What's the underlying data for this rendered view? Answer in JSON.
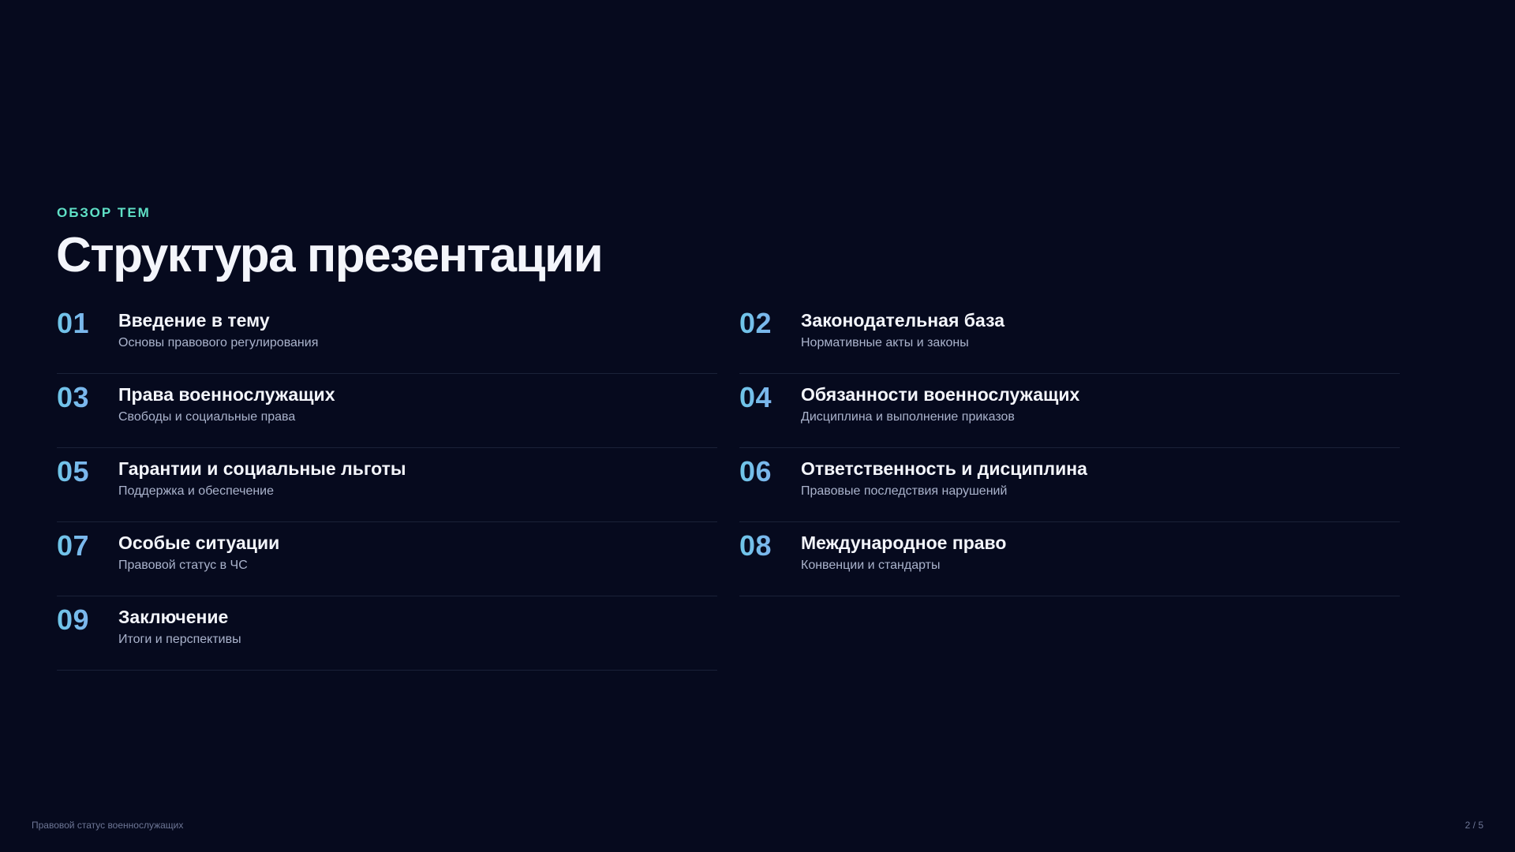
{
  "header": {
    "eyebrow": "ОБЗОР ТЕМ",
    "title": "Структура презентации"
  },
  "items": [
    {
      "num": "01",
      "title": "Введение в тему",
      "subtitle": "Основы правового регулирования"
    },
    {
      "num": "02",
      "title": "Законодательная база",
      "subtitle": "Нормативные акты и законы"
    },
    {
      "num": "03",
      "title": "Права военнослужащих",
      "subtitle": "Свободы и социальные права"
    },
    {
      "num": "04",
      "title": "Обязанности военнослужащих",
      "subtitle": "Дисциплина и выполнение приказов"
    },
    {
      "num": "05",
      "title": "Гарантии и социальные льготы",
      "subtitle": "Поддержка и обеспечение"
    },
    {
      "num": "06",
      "title": "Ответственность и дисциплина",
      "subtitle": "Правовые последствия нарушений"
    },
    {
      "num": "07",
      "title": "Особые ситуации",
      "subtitle": "Правовой статус в ЧС"
    },
    {
      "num": "08",
      "title": "Международное право",
      "subtitle": "Конвенции и стандарты"
    },
    {
      "num": "09",
      "title": "Заключение",
      "subtitle": "Итоги и перспективы"
    }
  ],
  "footer": {
    "left": "Правовой статус военнослужащих",
    "page": "2 / 5"
  },
  "colors": {
    "background": "#060a1e",
    "accent": "#5fe0c6",
    "number_gradient_start": "#6ec6e8",
    "number_gradient_end": "#8aa4f2"
  }
}
